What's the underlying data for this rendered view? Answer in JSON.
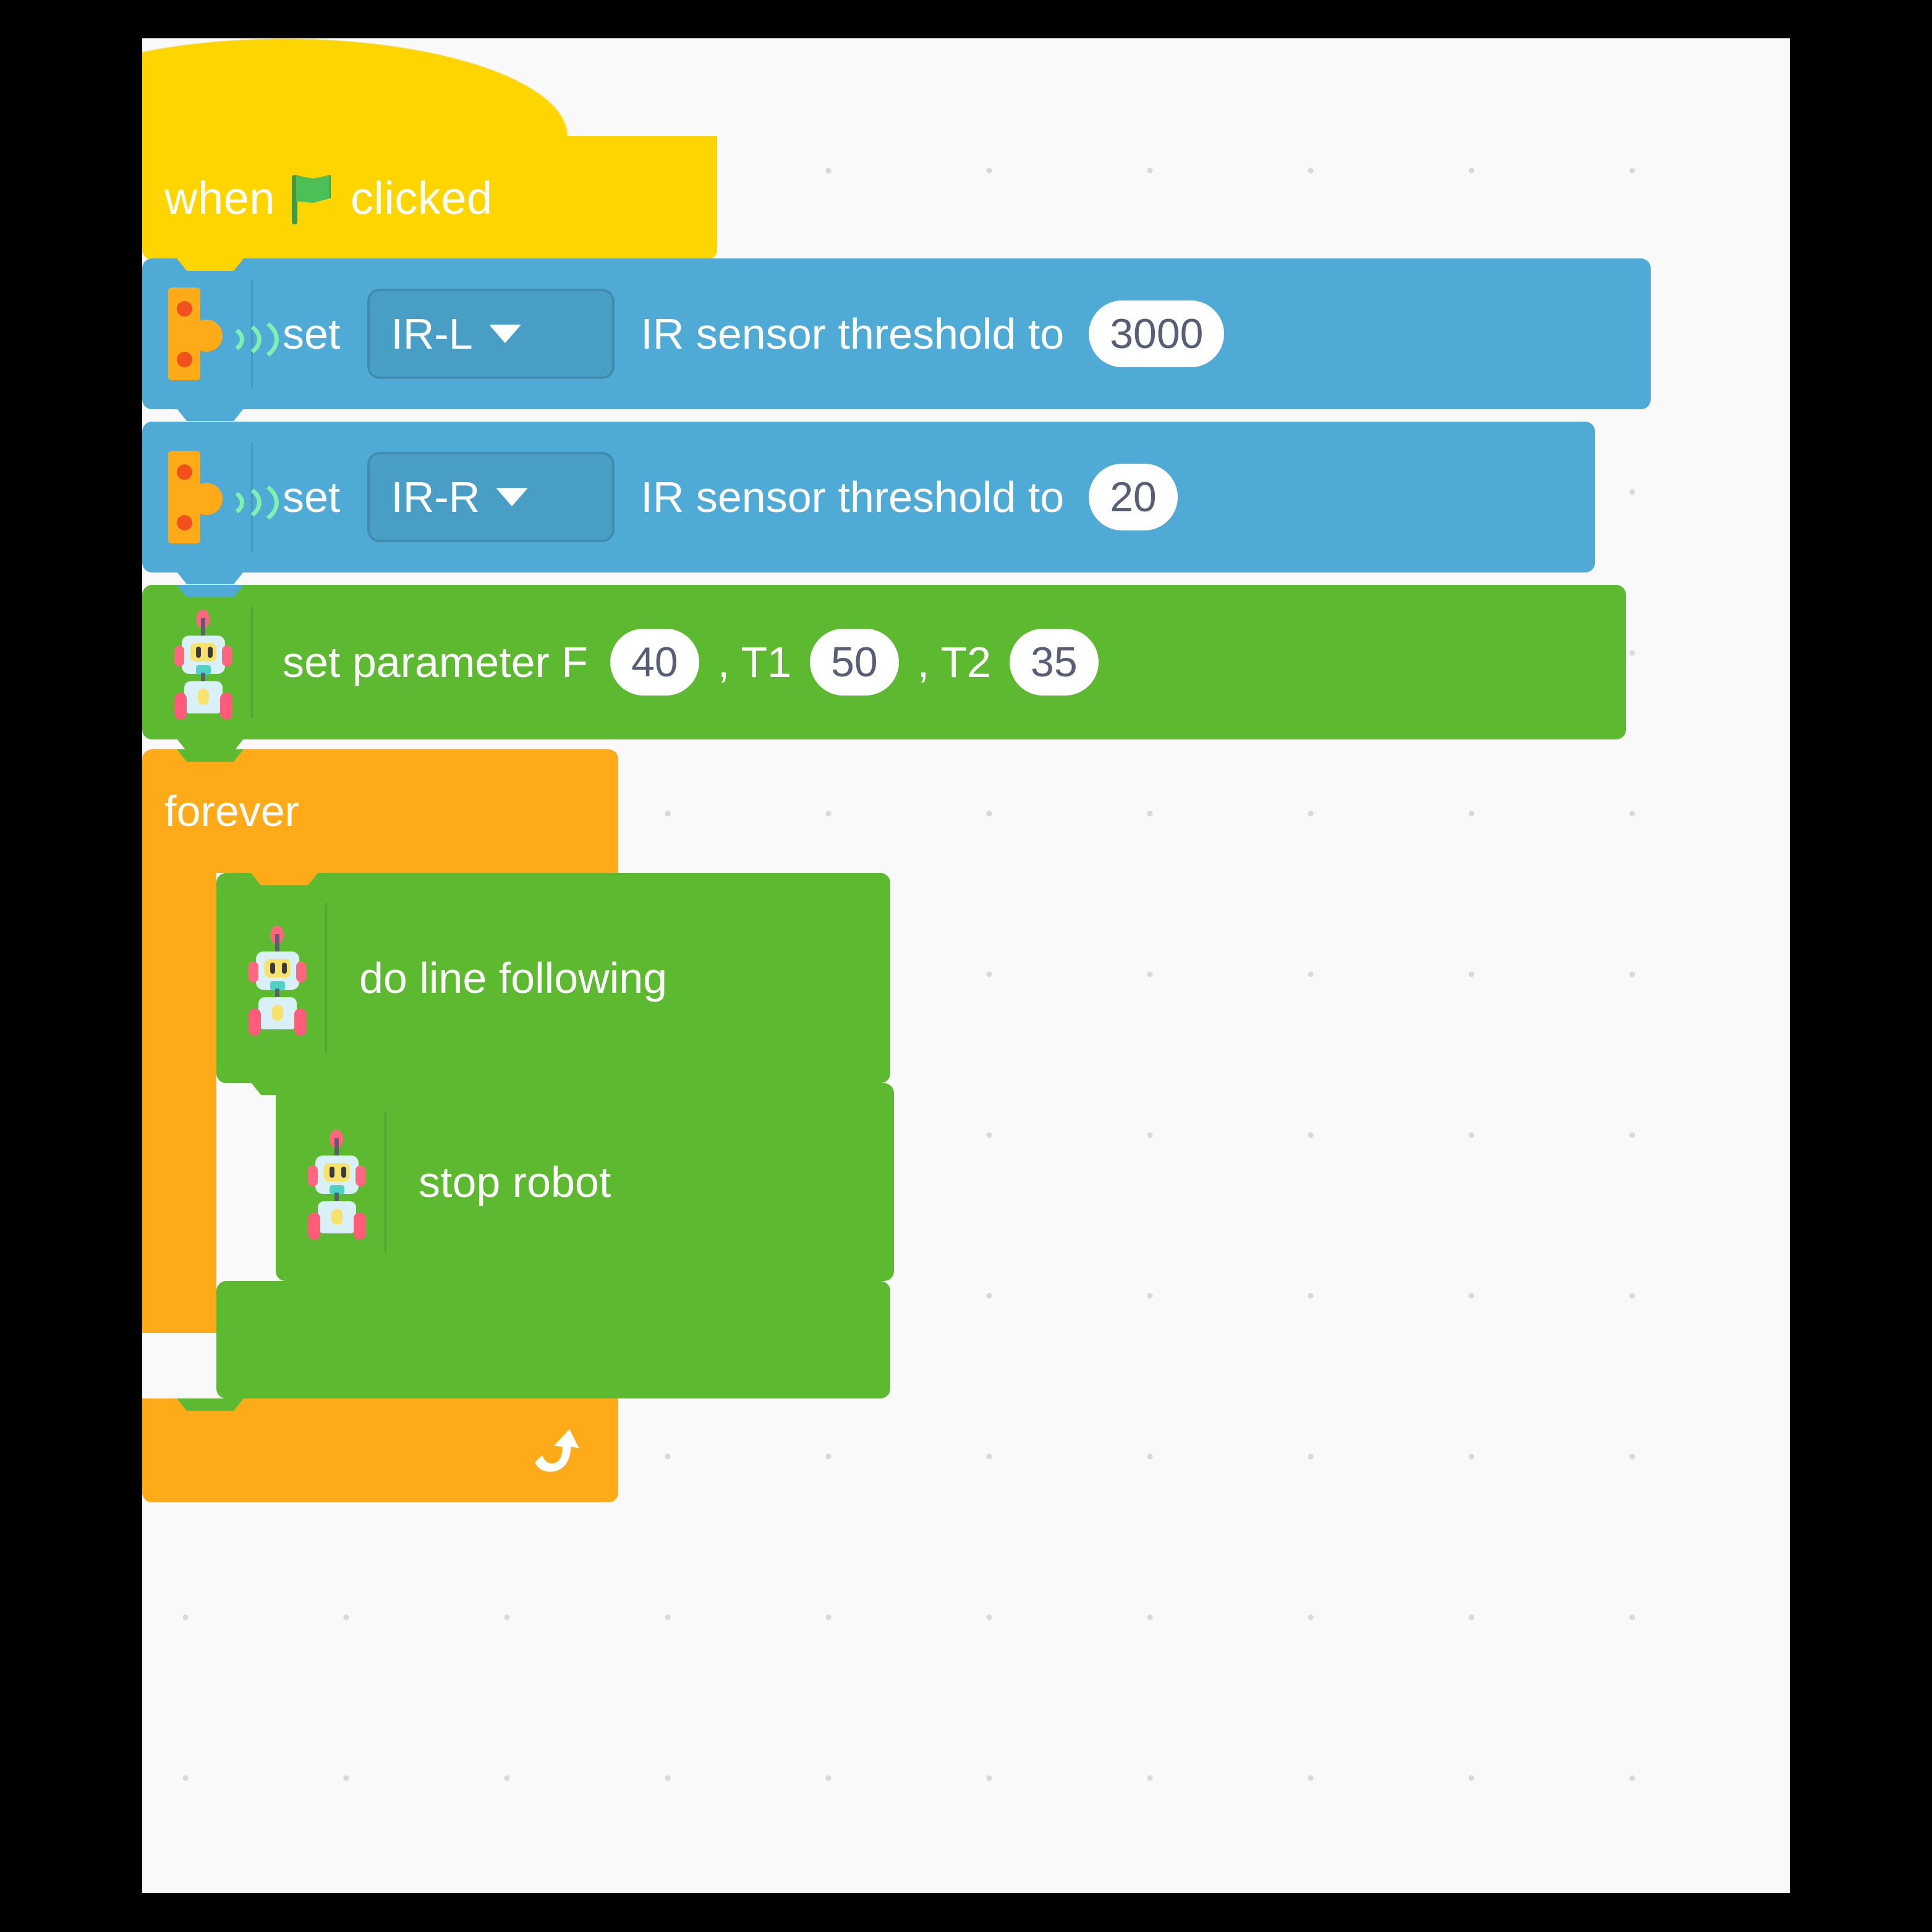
{
  "workspace": {
    "background_color": "#f9f9f9",
    "dot_color": "#d9d9d9"
  },
  "palette": {
    "event_yellow": "#ffd500",
    "sensor_blue": "#4fabd6",
    "robot_green": "#5cb930",
    "control_orange": "#ffab19",
    "field_white": "#ffffff",
    "field_text": "#575e75"
  },
  "script": {
    "hat": {
      "type": "event_whenflagclicked",
      "label_before": "when",
      "icon": "green-flag-icon",
      "label_after": "clicked"
    },
    "blocks": [
      {
        "id": "set-ir-threshold-1",
        "category": "sensor",
        "icon": "ir-sensor-icon",
        "label_before": "set",
        "dropdown_value": "IR-L",
        "label_after": "IR sensor threshold to",
        "value": "3000"
      },
      {
        "id": "set-ir-threshold-2",
        "category": "sensor",
        "icon": "ir-sensor-icon",
        "label_before": "set",
        "dropdown_value": "IR-R",
        "label_after": "IR sensor threshold to",
        "value": "20"
      },
      {
        "id": "set-parameter",
        "category": "robot",
        "icon": "robot-icon",
        "label_f": "set parameter F",
        "value_f": "40",
        "label_t1": ", T1",
        "value_t1": "50",
        "label_t2": ", T2",
        "value_t2": "35"
      }
    ],
    "forever": {
      "id": "control-forever",
      "category": "control",
      "label": "forever",
      "loop_icon": "loop-arrow-icon",
      "children": [
        {
          "id": "do-line-following",
          "category": "robot",
          "icon": "robot-icon",
          "label": "do line following"
        },
        {
          "id": "stop-robot",
          "category": "robot",
          "icon": "robot-icon",
          "label": "stop robot"
        },
        {
          "id": "empty-robot-block",
          "category": "robot",
          "icon": "",
          "label": ""
        }
      ]
    }
  }
}
